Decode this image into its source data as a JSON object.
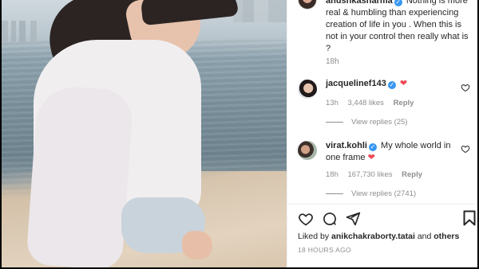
{
  "caption": {
    "username": "anushkasharma",
    "text": "Nothing is more real & humbling than experiencing creation of life in you . When this is not in your control then really what is ?",
    "time": "18h"
  },
  "comments": [
    {
      "username": "jacquelinef143",
      "text": "",
      "time": "13h",
      "likes": "3,448 likes",
      "reply_label": "Reply",
      "view_replies": "View replies (25)"
    },
    {
      "username": "virat.kohli",
      "text": "My whole world in one frame",
      "time": "18h",
      "likes": "167,730 likes",
      "reply_label": "Reply",
      "view_replies": "View replies (2741)"
    }
  ],
  "liked_by": {
    "prefix": "Liked by",
    "user": "anikchakraborty.tatai",
    "and": "and",
    "others": "others"
  },
  "timestamp": "18 HOURS AGO",
  "icons": {
    "like": "heart-outline-icon",
    "comment": "comment-icon",
    "share": "paper-plane-icon",
    "save": "bookmark-icon",
    "verified": "verified-badge-icon",
    "comment_like": "small-heart-outline-icon",
    "emoji": "red-heart-emoji"
  },
  "colors": {
    "verified": "#3897f0",
    "heart": "#ed4956",
    "muted": "#8e8e8e",
    "text": "#262626"
  }
}
